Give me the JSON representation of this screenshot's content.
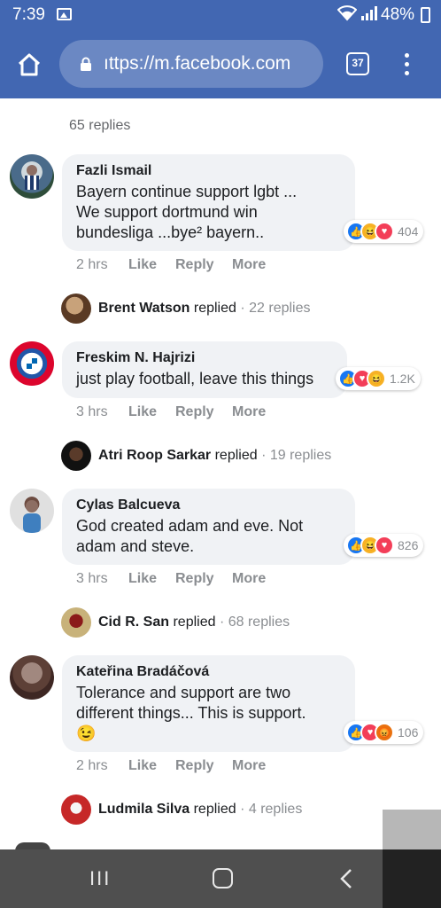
{
  "status_bar": {
    "time": "7:39",
    "battery": "48%",
    "icons": [
      "gallery-icon",
      "wifi-icon",
      "signal-icon",
      "battery-icon"
    ]
  },
  "browser": {
    "url": "ıttps://m.facebook.com",
    "tab_count": "37",
    "icons": [
      "home-icon",
      "lock-icon",
      "tabs-icon",
      "menu-icon"
    ],
    "theme_color": "#4267b2"
  },
  "thread": {
    "top_replies": "65 replies",
    "comments": [
      {
        "author": "Fazli Ismail",
        "lines": [
          "Bayern continue support lgbt ...",
          "We support dortmund win",
          "bundesliga ...bye² bayern.."
        ],
        "reaction_count": "404",
        "reactions": [
          "like",
          "haha",
          "love"
        ],
        "time": "2 hrs",
        "actions": [
          "Like",
          "Reply",
          "More"
        ],
        "reply_by": "Brent Watson",
        "reply_verb": "replied",
        "reply_count": "· 22 replies"
      },
      {
        "author": "Freskim N. Hajrizi",
        "lines": [
          "just play football, leave this things"
        ],
        "reaction_count": "1.2K",
        "reactions": [
          "like",
          "love",
          "haha"
        ],
        "time": "3 hrs",
        "actions": [
          "Like",
          "Reply",
          "More"
        ],
        "reply_by": "Atri Roop Sarkar",
        "reply_verb": "replied",
        "reply_count": "· 19 replies"
      },
      {
        "author": "Cylas Balcueva",
        "lines": [
          "God created adam and eve. Not",
          "adam and steve."
        ],
        "reaction_count": "826",
        "reactions": [
          "like",
          "haha",
          "love"
        ],
        "time": "3 hrs",
        "actions": [
          "Like",
          "Reply",
          "More"
        ],
        "reply_by": "Cid R. San",
        "reply_verb": "replied",
        "reply_count": "· 68 replies"
      },
      {
        "author": "Kateřina Bradáčová",
        "lines": [
          "Tolerance and support are two",
          "different things... This is support.",
          "😉"
        ],
        "reaction_count": "106",
        "reactions": [
          "like",
          "love",
          "angry"
        ],
        "time": "2 hrs",
        "actions": [
          "Like",
          "Reply",
          "More"
        ],
        "reply_by": "Ludmila Silva",
        "reply_verb": "replied",
        "reply_count": "· 4 replies"
      }
    ]
  },
  "nav": {
    "icons": [
      "recent-apps-icon",
      "home-circle-icon",
      "back-icon"
    ],
    "recent": "III"
  }
}
